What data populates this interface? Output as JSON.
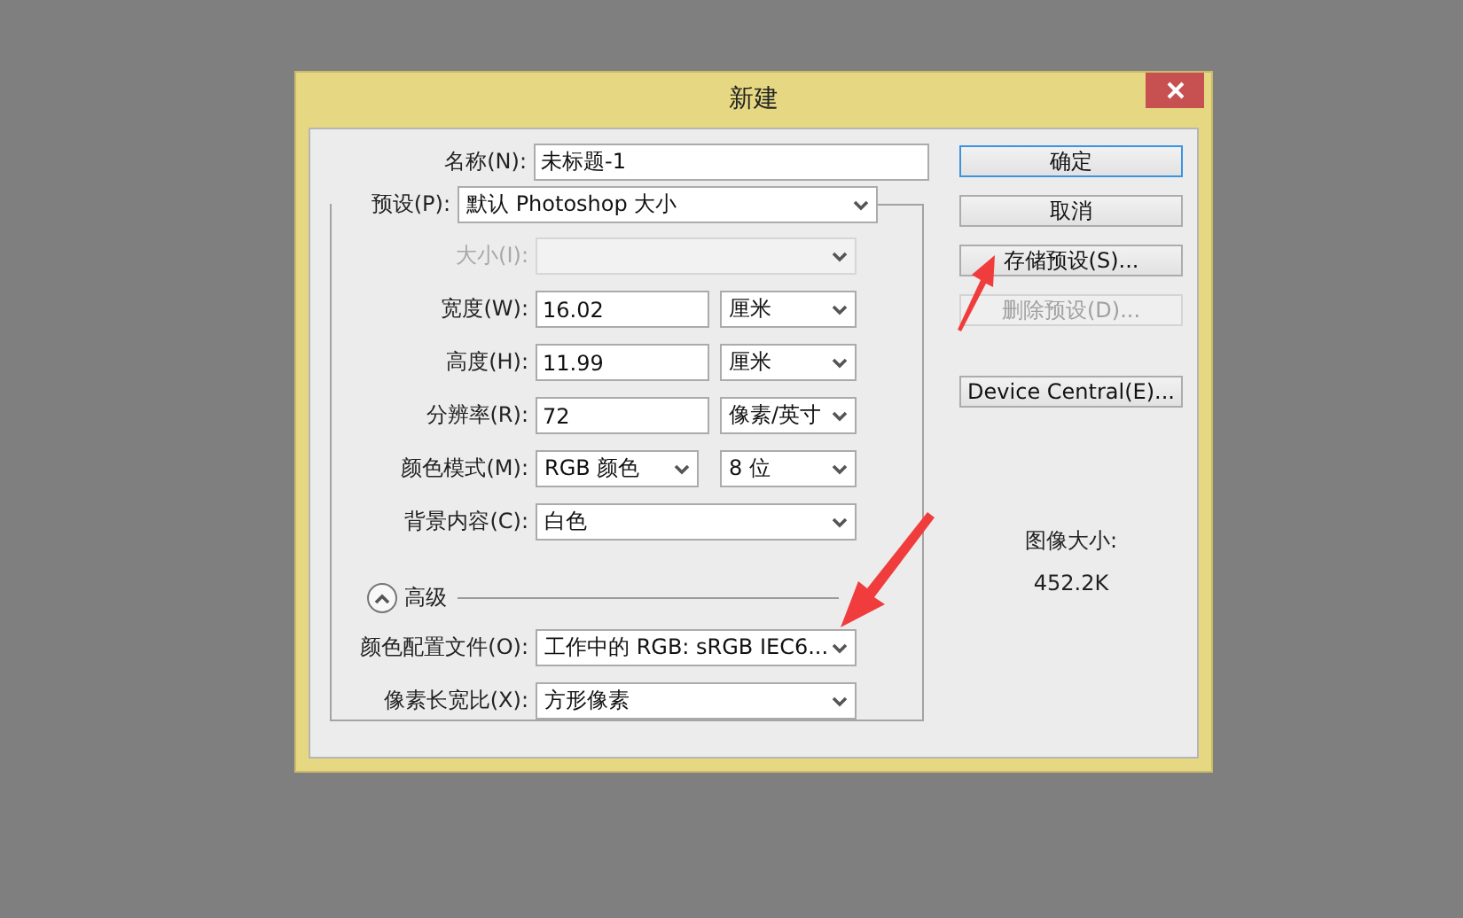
{
  "window": {
    "title": "新建"
  },
  "name_field": {
    "label": "名称(N):",
    "value": "未标题-1"
  },
  "preset": {
    "label": "预设(P):",
    "value": "默认 Photoshop 大小"
  },
  "rows": [
    {
      "label": "大小(I):",
      "disabled": true,
      "inputs": [
        {
          "kind": "select",
          "disabled": true
        }
      ]
    },
    {
      "label": "宽度(W):",
      "disabled": false,
      "inputs": [
        {
          "kind": "text",
          "value": "16.02",
          "disabled": false
        },
        {
          "kind": "select",
          "value": "厘米",
          "disabled": false
        }
      ]
    },
    {
      "label": "高度(H):",
      "disabled": false,
      "inputs": [
        {
          "kind": "text",
          "value": "11.99",
          "disabled": false
        },
        {
          "kind": "select",
          "value": "厘米",
          "disabled": false
        }
      ]
    },
    {
      "label": "分辨率(R):",
      "disabled": false,
      "inputs": [
        {
          "kind": "text",
          "value": "72",
          "disabled": false
        },
        {
          "kind": "select",
          "value": "像素/英寸",
          "disabled": false
        }
      ]
    },
    {
      "label": "颜色模式(M):",
      "disabled": false,
      "inputs": [
        {
          "kind": "select",
          "value": "RGB 颜色",
          "disabled": false
        },
        {
          "kind": "select",
          "value": "8 位",
          "disabled": false
        }
      ]
    },
    {
      "label": "背景内容(C):",
      "disabled": false,
      "inputs": [
        {
          "kind": "select",
          "value": "白色",
          "disabled": false
        }
      ]
    }
  ],
  "advanced": {
    "label": "高级",
    "expanded": true
  },
  "advanced_rows": [
    {
      "label": "颜色配置文件(O):",
      "disabled": false,
      "inputs": [
        {
          "kind": "select",
          "value": "工作中的 RGB: sRGB IEC6...",
          "disabled": false
        }
      ]
    },
    {
      "label": "像素长宽比(X):",
      "disabled": false,
      "inputs": [
        {
          "kind": "select",
          "value": "方形像素",
          "disabled": false
        }
      ]
    }
  ],
  "buttons": [
    {
      "label": "确定",
      "default": true,
      "disabled": false
    },
    {
      "label": "取消",
      "default": false,
      "disabled": false
    },
    {
      "label": "存储预设(S)...",
      "default": false,
      "disabled": false
    },
    {
      "label": "删除预设(D)...",
      "default": false,
      "disabled": true
    },
    {
      "label": "Device Central(E)...",
      "default": false,
      "disabled": false
    }
  ],
  "image_size": {
    "label": "图像大小:",
    "value": "452.2K"
  },
  "annotations": [
    {
      "kind": "arrow"
    },
    {
      "kind": "arrow"
    }
  ]
}
